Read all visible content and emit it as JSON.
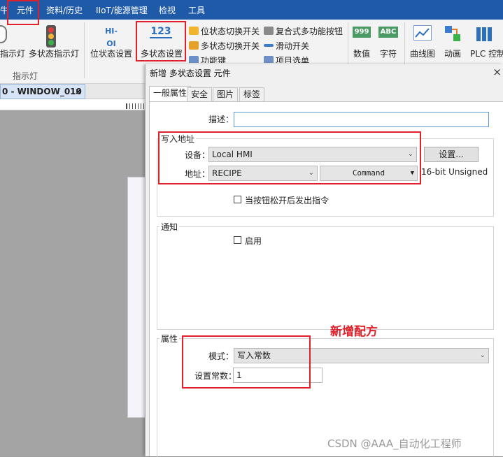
{
  "menu": {
    "items": [
      "牛",
      "元件",
      "资料/历史",
      "IIoT/能源管理",
      "检视",
      "工具"
    ]
  },
  "ribbon": {
    "lamp_group": {
      "label1": "指示灯",
      "label2": "多状态指示灯",
      "group_label": "指示灯"
    },
    "switch_group": {
      "bit_set": "位状态设置",
      "multi_set": "多状态设置",
      "bit_toggle": "位状态切换开关",
      "multi_toggle": "多状态切换开关",
      "function_key": "功能键",
      "combo_button": "复合式多功能按钮",
      "slide_switch": "滑动开关",
      "item_select": "项目选单"
    },
    "display_group": {
      "numeric": "数值",
      "char": "字符",
      "numeric_icon_text": "999",
      "char_icon_text": "ABC"
    },
    "chart_group": {
      "trend": "曲线图",
      "animation": "动画",
      "plc": "PLC 控制"
    },
    "bit_icon_text": "HI-OI",
    "multi_icon_text": "123"
  },
  "document": {
    "tab_label": "0 - WINDOW_010",
    "tab_close": "×"
  },
  "dialog": {
    "title": "新增 多状态设置 元件",
    "close": "×",
    "tabs": [
      "一般属性",
      "安全",
      "图片",
      "标签"
    ],
    "description_label": "描述：",
    "description_value": "",
    "write_address": {
      "title": "写入地址",
      "device_label": "设备：",
      "device_value": "Local HMI",
      "settings_button": "设置...",
      "address_label": "地址：",
      "address_value": "RECIPE",
      "command_value": "Command",
      "data_type": "16-bit Unsigned",
      "release_checkbox": "当按钮松开后发出指令"
    },
    "notify": {
      "title": "通知",
      "enable_checkbox": "启用"
    },
    "attributes": {
      "title": "属性",
      "mode_label": "模式：",
      "mode_value": "写入常数",
      "const_label": "设置常数：",
      "const_value": "1"
    }
  },
  "annotation": {
    "text": "新增配方",
    "color": "#e0202a"
  },
  "watermark": "CSDN @AAA_自动化工程师",
  "colors": {
    "menubar": "#1f5aa8",
    "ribbon": "#f3f3f3",
    "dialog": "#f0f0f0"
  }
}
